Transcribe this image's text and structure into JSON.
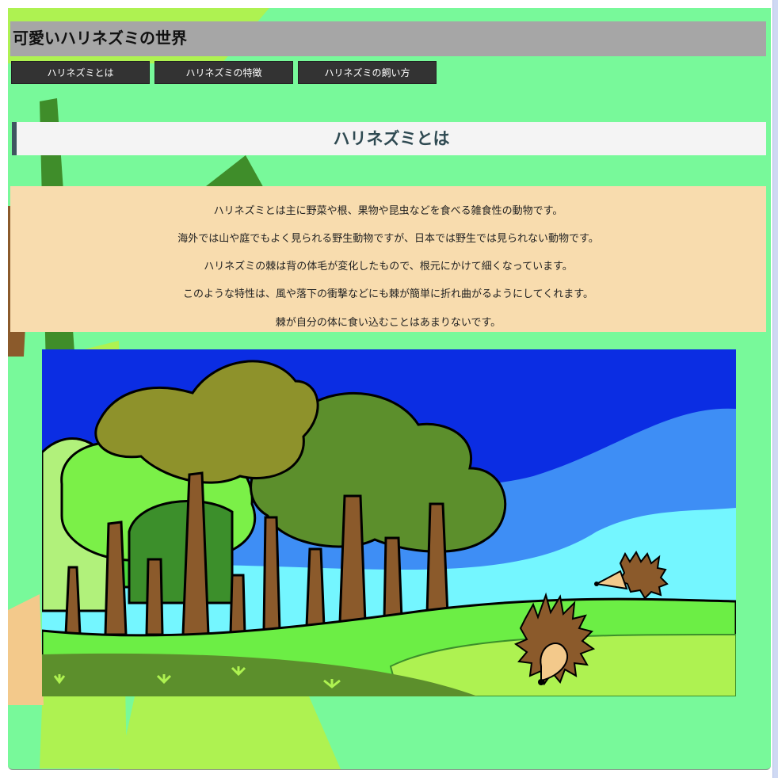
{
  "site": {
    "title": "可愛いハリネズミの世界"
  },
  "nav": {
    "items": [
      {
        "label": "ハリネズミとは"
      },
      {
        "label": "ハリネズミの特徴"
      },
      {
        "label": "ハリネズミの飼い方"
      }
    ]
  },
  "section": {
    "title": "ハリネズミとは",
    "paragraphs": [
      "ハリネズミとは主に野菜や根、果物や昆虫などを食べる雑食性の動物です。",
      "海外では山や庭でもよく見られる野生動物ですが、日本では野生では見られない動物です。",
      "ハリネズミの棘は背の体毛が変化したもので、根元にかけて細くなっています。",
      "このような特性は、風や落下の衝撃などにも棘が簡単に折れ曲がるようにしてくれます。",
      "棘が自分の体に食い込むことはあまりないです。"
    ]
  },
  "colors": {
    "page_background": "#78f99a",
    "header_bar": "#a6a6a6",
    "nav_button": "#333333",
    "section_title_text": "#2f4a52",
    "text_box": "#f8dcae"
  }
}
